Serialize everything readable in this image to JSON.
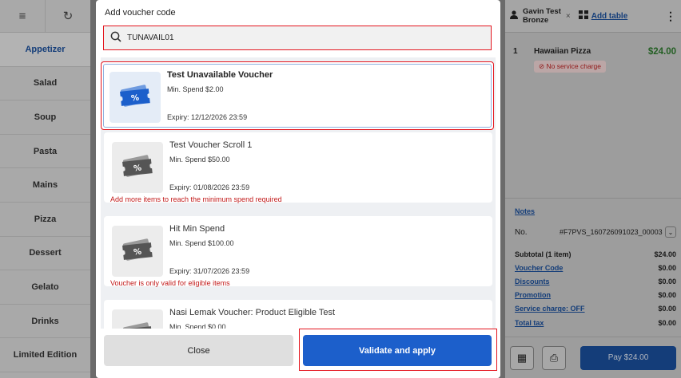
{
  "categories": [
    "Appetizer",
    "Salad",
    "Soup",
    "Pasta",
    "Mains",
    "Pizza",
    "Dessert",
    "Gelato",
    "Drinks",
    "Limited Edition"
  ],
  "right_panel": {
    "customer_name": "Gavin Test",
    "customer_tier": "Bronze",
    "close_glyph": "×",
    "add_table_label": "Add table",
    "order_item": {
      "qty": "1",
      "name": "Hawaiian Pizza",
      "price": "$24.00",
      "badge": "No service charge"
    },
    "notes_label": "Notes",
    "order_no_label": "No.",
    "order_no_value": "#F7PVS_160726091023_00003",
    "totals": [
      {
        "label": "Subtotal (1 item)",
        "value": "$24.00",
        "link": false
      },
      {
        "label": "Voucher Code",
        "value": "$0.00",
        "link": true
      },
      {
        "label": "Discounts",
        "value": "$0.00",
        "link": true
      },
      {
        "label": "Promotion",
        "value": "$0.00",
        "link": true
      },
      {
        "label": "Service charge: OFF",
        "value": "$0.00",
        "link": true
      },
      {
        "label": "Total tax",
        "value": "$0.00",
        "link": true
      }
    ],
    "pay_label": "Pay $24.00"
  },
  "modal": {
    "title": "Add voucher code",
    "search_value": "TUNAVAIL01",
    "vouchers": [
      {
        "name": "Test Unavailable Voucher",
        "min_spend": "Min. Spend $2.00",
        "expiry": "Expiry: 12/12/2026 23:59",
        "warning": "",
        "style": "blue"
      },
      {
        "name": "Test Voucher Scroll 1",
        "min_spend": "Min. Spend $50.00",
        "expiry": "Expiry: 01/08/2026 23:59",
        "warning": "Add more items to reach the minimum spend required",
        "style": "gray"
      },
      {
        "name": "Hit Min Spend",
        "min_spend": "Min. Spend $100.00",
        "expiry": "Expiry: 31/07/2026 23:59",
        "warning": "Voucher is only valid for eligible items",
        "style": "gray"
      },
      {
        "name": "Nasi Lemak Voucher: Product Eligible Test",
        "min_spend": "Min. Spend $0.00",
        "expiry": "",
        "warning": "",
        "style": "gray"
      }
    ],
    "close_label": "Close",
    "apply_label": "Validate and apply"
  },
  "colors": {
    "primary": "#1c5fcb",
    "highlight": "#e4141d",
    "warning_text": "#c21a1a",
    "price_green": "#2f7a2f"
  },
  "icons": [
    "menu-icon",
    "refresh-icon",
    "search-icon",
    "voucher-icon",
    "person-icon",
    "table-icon",
    "more-vert-icon",
    "chevron-down-icon",
    "calculator-icon",
    "printer-icon"
  ]
}
